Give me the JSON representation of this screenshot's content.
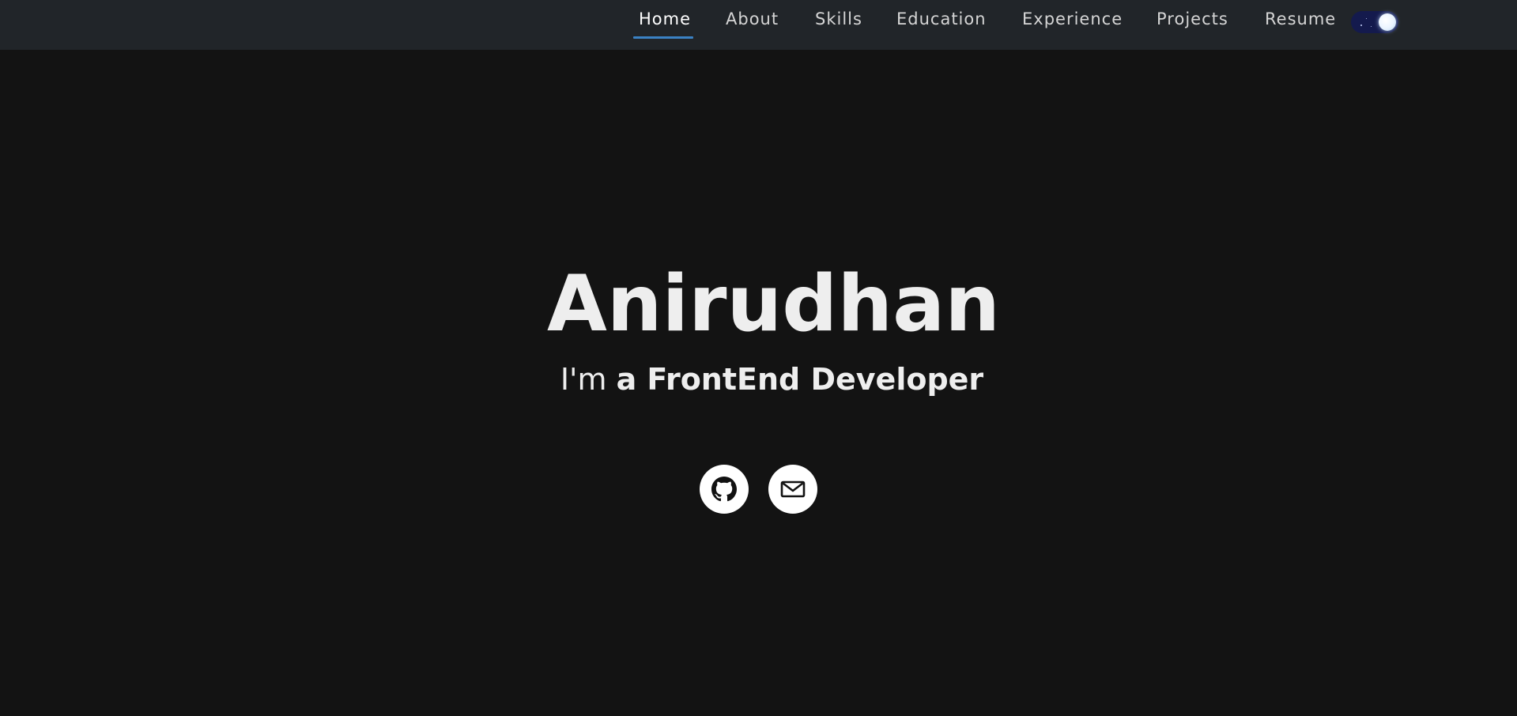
{
  "nav": {
    "links": [
      "Home",
      "About",
      "Skills",
      "Education",
      "Experience",
      "Projects",
      "Resume"
    ],
    "active": "Home",
    "theme_toggle": {
      "mode": "dark",
      "icon": "moon-icon"
    }
  },
  "hero": {
    "name": "Anirudhan",
    "tagline_prefix": "I'm ",
    "tagline_emphasis": "a FrontEnd Developer"
  },
  "social": {
    "github": {
      "icon": "github-icon"
    },
    "email": {
      "icon": "mail-icon"
    }
  },
  "colors": {
    "background": "#131313",
    "navbar": "#212529",
    "active_underline": "#3b82c4",
    "text": "#eeeeee",
    "toggle_track": "#141a4d"
  }
}
